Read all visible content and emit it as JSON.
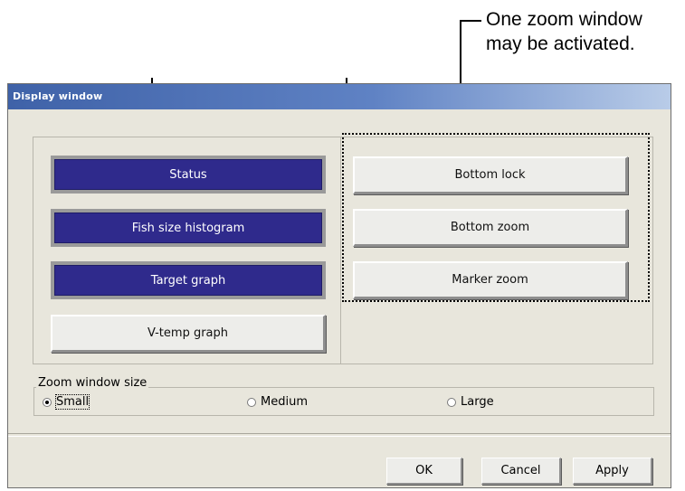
{
  "annotation": {
    "line1": "One zoom window",
    "line2": "may be activated."
  },
  "window": {
    "title": "Display window"
  },
  "left_buttons": [
    {
      "label": "Status",
      "active": true
    },
    {
      "label": "Fish size histogram",
      "active": true
    },
    {
      "label": "Target graph",
      "active": true
    },
    {
      "label": "V-temp graph",
      "active": false
    }
  ],
  "right_buttons": [
    {
      "label": "Bottom lock",
      "active": false
    },
    {
      "label": "Bottom zoom",
      "active": false
    },
    {
      "label": "Marker zoom",
      "active": false
    }
  ],
  "zoom_size": {
    "legend": "Zoom window size",
    "options": [
      {
        "label": "Small",
        "selected": true
      },
      {
        "label": "Medium",
        "selected": false
      },
      {
        "label": "Large",
        "selected": false
      }
    ]
  },
  "footer": {
    "ok": "OK",
    "cancel": "Cancel",
    "apply": "Apply"
  },
  "colors": {
    "active_button": "#2f2a8c",
    "titlebar_start": "#3f62a8",
    "dialog_face": "#e8e6dc"
  }
}
